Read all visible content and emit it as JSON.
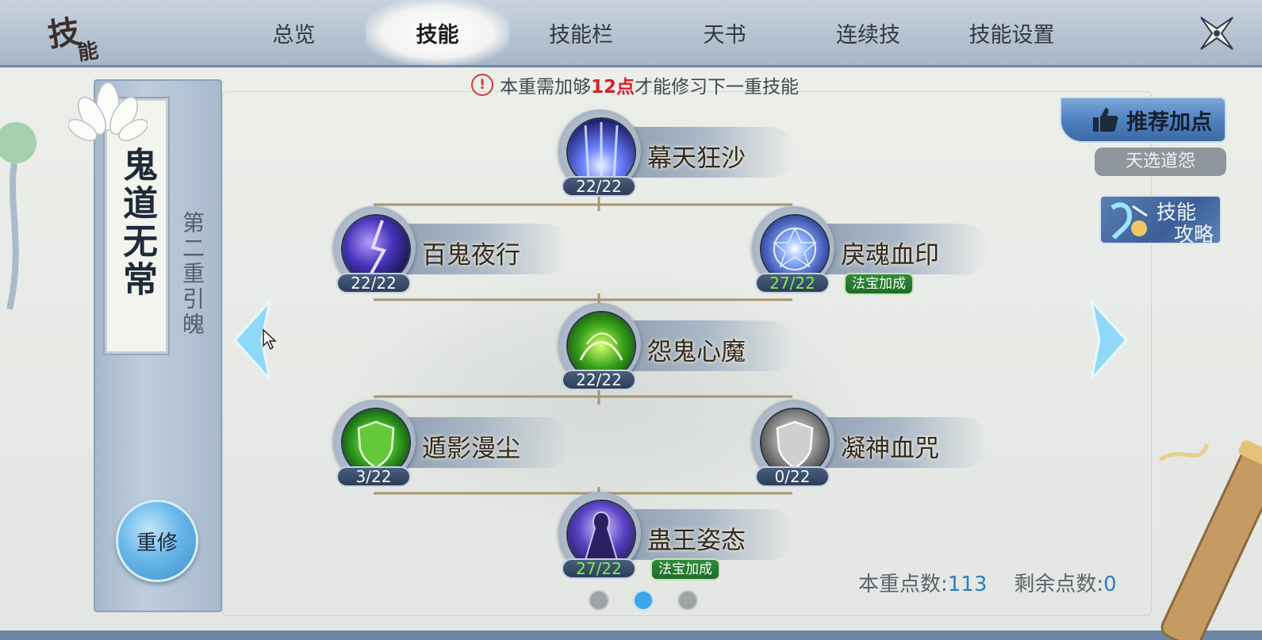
{
  "header": {
    "logo_main": "技",
    "logo_sub": "能",
    "tabs": [
      {
        "label": "总览",
        "active": false
      },
      {
        "label": "技能",
        "active": true
      },
      {
        "label": "技能栏",
        "active": false
      },
      {
        "label": "天书",
        "active": false
      },
      {
        "label": "连续技",
        "active": false
      },
      {
        "label": "技能设置",
        "active": false
      }
    ],
    "close_icon": "close-icon"
  },
  "left_panel": {
    "school_name": "鬼道无常",
    "tier": "第二重引魄",
    "reset_label": "重修"
  },
  "notice": {
    "prefix": "本重需加够",
    "highlight": "12点",
    "suffix": "才能修习下一重技能"
  },
  "skills": [
    {
      "name": "幕天狂沙",
      "level": "22/22",
      "over": false,
      "badge": ""
    },
    {
      "name": "百鬼夜行",
      "level": "22/22",
      "over": false,
      "badge": ""
    },
    {
      "name": "戾魂血印",
      "level": "27/22",
      "over": true,
      "badge": "法宝加成"
    },
    {
      "name": "怨鬼心魔",
      "level": "22/22",
      "over": false,
      "badge": ""
    },
    {
      "name": "遁影漫尘",
      "level": "3/22",
      "over": false,
      "badge": ""
    },
    {
      "name": "凝神血咒",
      "level": "0/22",
      "over": false,
      "badge": ""
    },
    {
      "name": "蛊王姿态",
      "level": "27/22",
      "over": true,
      "badge": "法宝加成"
    }
  ],
  "right_panel": {
    "recommend_label": "推荐加点",
    "preset_label": "天选道怨",
    "guide_line1": "技能",
    "guide_line2": "攻略"
  },
  "footer": {
    "tier_points_label": "本重点数:",
    "tier_points_value": "113",
    "remaining_label": "剩余点数:",
    "remaining_value": "0",
    "pages": 3,
    "current_page": 2
  },
  "colors": {
    "highlight_red": "#d6202a",
    "over_level_green": "#7df04c",
    "badge_green": "#2f8a3b",
    "points_blue": "#2a7fc7",
    "active_dot": "#3aa7e6"
  }
}
